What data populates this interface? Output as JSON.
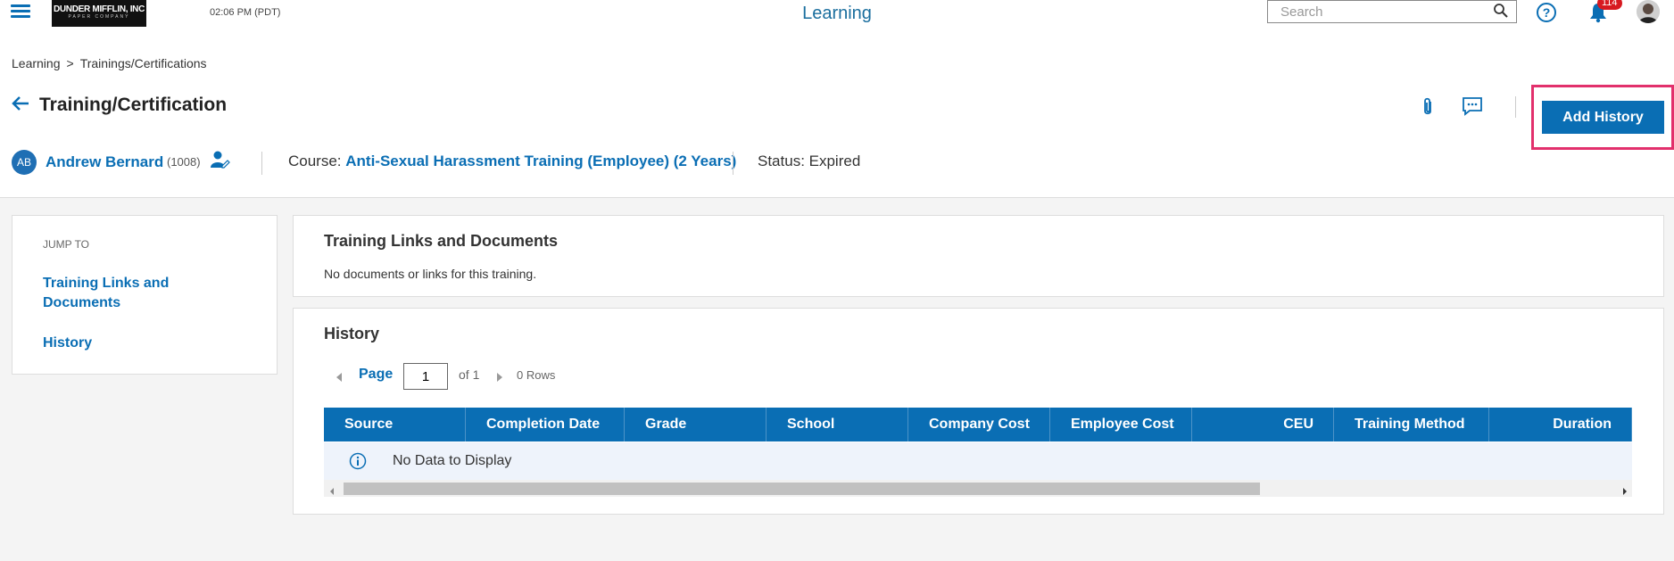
{
  "topbar": {
    "logo_line1": "DUNDER MIFFLIN, INC",
    "logo_line2": "PAPER COMPANY",
    "time": "02:06 PM (PDT)",
    "app_title": "Learning",
    "search_placeholder": "Search",
    "notification_count": "114"
  },
  "breadcrumb": {
    "items": [
      "Learning",
      "Trainings/Certifications"
    ],
    "separator": ">"
  },
  "header": {
    "title": "Training/Certification",
    "add_history_label": "Add History",
    "employee": {
      "initials": "AB",
      "name": "Andrew Bernard",
      "id": "(1008)"
    },
    "course_label": "Course:",
    "course_name": "Anti-Sexual Harassment Training (Employee) (2 Years)",
    "status": "Status: Expired"
  },
  "jump_to": {
    "label": "JUMP TO",
    "links": [
      "Training Links and Documents",
      "History"
    ]
  },
  "documents_card": {
    "title": "Training Links and Documents",
    "empty_text": "No documents or links for this training."
  },
  "history_card": {
    "title": "History",
    "page_label": "Page",
    "page_value": "1",
    "of_text": "of 1",
    "rows_text": "0 Rows",
    "columns": [
      "Source",
      "Completion Date",
      "Grade",
      "School",
      "Company Cost",
      "Employee Cost",
      "CEU",
      "Training Method",
      "Duration"
    ],
    "no_data_text": "No Data to Display"
  },
  "colors": {
    "accent": "#0a6eb4",
    "highlight": "#e2306c",
    "badge": "#d71920"
  }
}
